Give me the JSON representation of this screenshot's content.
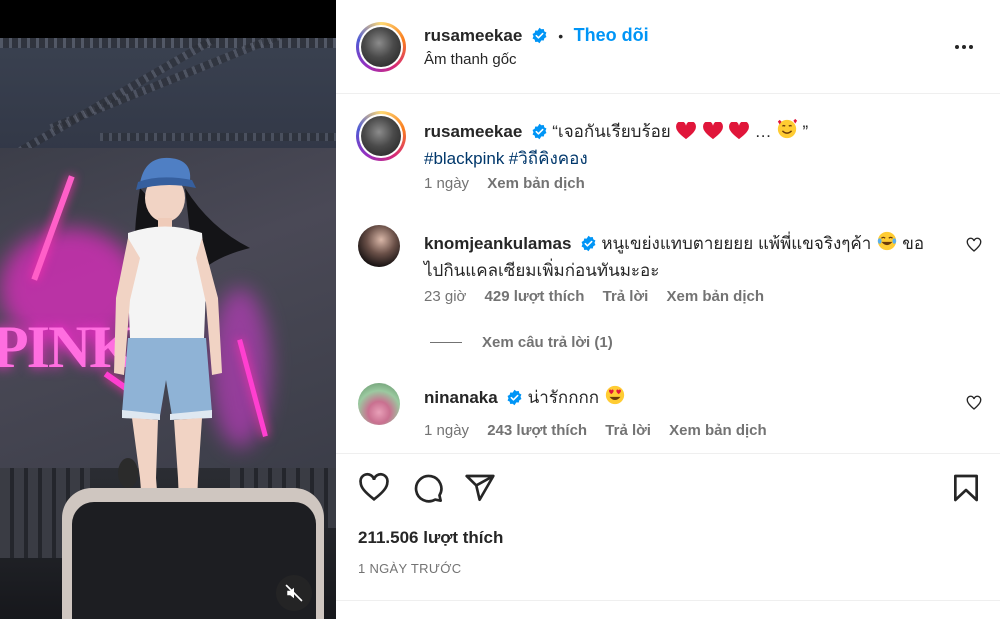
{
  "post_header": {
    "username": "rusameekae",
    "separator": "•",
    "follow_label": "Theo dõi",
    "audio_label": "Âm thanh gốc"
  },
  "caption": {
    "username": "rusameekae",
    "quote_open": "“เจอกันเรียบร้อย",
    "quote_close": "…",
    "quote_end": "”",
    "hashtag1": "#blackpink",
    "hashtag2": "#วิถีคิงคอง",
    "time": "1 ngày",
    "translate": "Xem bản dịch"
  },
  "comments": [
    {
      "username": "knomjeankulamas",
      "text_part1": "หนูเขย่งแทบตายยยย แพ้พี่แขจริงๆค้า",
      "text_part2": "ขอ",
      "text_line2": "ไปกินแคลเซียมเพิ่มก่อนทันมะอะ",
      "time": "23 giờ",
      "likes": "429 lượt thích",
      "reply": "Trả lời",
      "translate": "Xem bản dịch",
      "view_replies": "Xem câu trả lời (1)"
    },
    {
      "username": "ninanaka",
      "text": "น่ารักกกก",
      "time": "1 ngày",
      "likes": "243 lượt thích",
      "reply": "Trả lời",
      "translate": "Xem bản dịch"
    }
  ],
  "footer": {
    "likes": "211.506 lượt thích",
    "date": "1 NGÀY TRƯỚC"
  },
  "icons": {
    "like": "heart-icon",
    "comment": "comment-icon",
    "share": "send-icon",
    "save": "bookmark-icon",
    "more": "more-options-icon",
    "mute": "muted-speaker-icon",
    "verified": "verified-badge-icon"
  },
  "colors": {
    "accent": "#0095f6",
    "hashtag": "#00376b",
    "muted_text": "#737373",
    "verified": "#0095f6"
  }
}
